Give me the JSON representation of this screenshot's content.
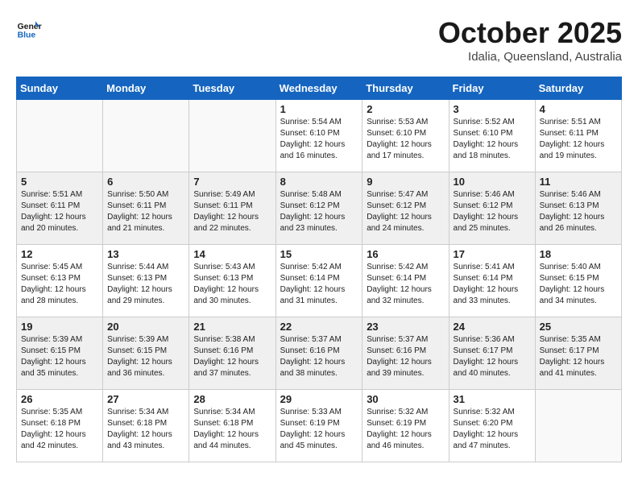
{
  "header": {
    "logo_line1": "General",
    "logo_line2": "Blue",
    "month": "October 2025",
    "location": "Idalia, Queensland, Australia"
  },
  "weekdays": [
    "Sunday",
    "Monday",
    "Tuesday",
    "Wednesday",
    "Thursday",
    "Friday",
    "Saturday"
  ],
  "weeks": [
    [
      {
        "day": "",
        "info": ""
      },
      {
        "day": "",
        "info": ""
      },
      {
        "day": "",
        "info": ""
      },
      {
        "day": "1",
        "info": "Sunrise: 5:54 AM\nSunset: 6:10 PM\nDaylight: 12 hours\nand 16 minutes."
      },
      {
        "day": "2",
        "info": "Sunrise: 5:53 AM\nSunset: 6:10 PM\nDaylight: 12 hours\nand 17 minutes."
      },
      {
        "day": "3",
        "info": "Sunrise: 5:52 AM\nSunset: 6:10 PM\nDaylight: 12 hours\nand 18 minutes."
      },
      {
        "day": "4",
        "info": "Sunrise: 5:51 AM\nSunset: 6:11 PM\nDaylight: 12 hours\nand 19 minutes."
      }
    ],
    [
      {
        "day": "5",
        "info": "Sunrise: 5:51 AM\nSunset: 6:11 PM\nDaylight: 12 hours\nand 20 minutes."
      },
      {
        "day": "6",
        "info": "Sunrise: 5:50 AM\nSunset: 6:11 PM\nDaylight: 12 hours\nand 21 minutes."
      },
      {
        "day": "7",
        "info": "Sunrise: 5:49 AM\nSunset: 6:11 PM\nDaylight: 12 hours\nand 22 minutes."
      },
      {
        "day": "8",
        "info": "Sunrise: 5:48 AM\nSunset: 6:12 PM\nDaylight: 12 hours\nand 23 minutes."
      },
      {
        "day": "9",
        "info": "Sunrise: 5:47 AM\nSunset: 6:12 PM\nDaylight: 12 hours\nand 24 minutes."
      },
      {
        "day": "10",
        "info": "Sunrise: 5:46 AM\nSunset: 6:12 PM\nDaylight: 12 hours\nand 25 minutes."
      },
      {
        "day": "11",
        "info": "Sunrise: 5:46 AM\nSunset: 6:13 PM\nDaylight: 12 hours\nand 26 minutes."
      }
    ],
    [
      {
        "day": "12",
        "info": "Sunrise: 5:45 AM\nSunset: 6:13 PM\nDaylight: 12 hours\nand 28 minutes."
      },
      {
        "day": "13",
        "info": "Sunrise: 5:44 AM\nSunset: 6:13 PM\nDaylight: 12 hours\nand 29 minutes."
      },
      {
        "day": "14",
        "info": "Sunrise: 5:43 AM\nSunset: 6:13 PM\nDaylight: 12 hours\nand 30 minutes."
      },
      {
        "day": "15",
        "info": "Sunrise: 5:42 AM\nSunset: 6:14 PM\nDaylight: 12 hours\nand 31 minutes."
      },
      {
        "day": "16",
        "info": "Sunrise: 5:42 AM\nSunset: 6:14 PM\nDaylight: 12 hours\nand 32 minutes."
      },
      {
        "day": "17",
        "info": "Sunrise: 5:41 AM\nSunset: 6:14 PM\nDaylight: 12 hours\nand 33 minutes."
      },
      {
        "day": "18",
        "info": "Sunrise: 5:40 AM\nSunset: 6:15 PM\nDaylight: 12 hours\nand 34 minutes."
      }
    ],
    [
      {
        "day": "19",
        "info": "Sunrise: 5:39 AM\nSunset: 6:15 PM\nDaylight: 12 hours\nand 35 minutes."
      },
      {
        "day": "20",
        "info": "Sunrise: 5:39 AM\nSunset: 6:15 PM\nDaylight: 12 hours\nand 36 minutes."
      },
      {
        "day": "21",
        "info": "Sunrise: 5:38 AM\nSunset: 6:16 PM\nDaylight: 12 hours\nand 37 minutes."
      },
      {
        "day": "22",
        "info": "Sunrise: 5:37 AM\nSunset: 6:16 PM\nDaylight: 12 hours\nand 38 minutes."
      },
      {
        "day": "23",
        "info": "Sunrise: 5:37 AM\nSunset: 6:16 PM\nDaylight: 12 hours\nand 39 minutes."
      },
      {
        "day": "24",
        "info": "Sunrise: 5:36 AM\nSunset: 6:17 PM\nDaylight: 12 hours\nand 40 minutes."
      },
      {
        "day": "25",
        "info": "Sunrise: 5:35 AM\nSunset: 6:17 PM\nDaylight: 12 hours\nand 41 minutes."
      }
    ],
    [
      {
        "day": "26",
        "info": "Sunrise: 5:35 AM\nSunset: 6:18 PM\nDaylight: 12 hours\nand 42 minutes."
      },
      {
        "day": "27",
        "info": "Sunrise: 5:34 AM\nSunset: 6:18 PM\nDaylight: 12 hours\nand 43 minutes."
      },
      {
        "day": "28",
        "info": "Sunrise: 5:34 AM\nSunset: 6:18 PM\nDaylight: 12 hours\nand 44 minutes."
      },
      {
        "day": "29",
        "info": "Sunrise: 5:33 AM\nSunset: 6:19 PM\nDaylight: 12 hours\nand 45 minutes."
      },
      {
        "day": "30",
        "info": "Sunrise: 5:32 AM\nSunset: 6:19 PM\nDaylight: 12 hours\nand 46 minutes."
      },
      {
        "day": "31",
        "info": "Sunrise: 5:32 AM\nSunset: 6:20 PM\nDaylight: 12 hours\nand 47 minutes."
      },
      {
        "day": "",
        "info": ""
      }
    ]
  ]
}
